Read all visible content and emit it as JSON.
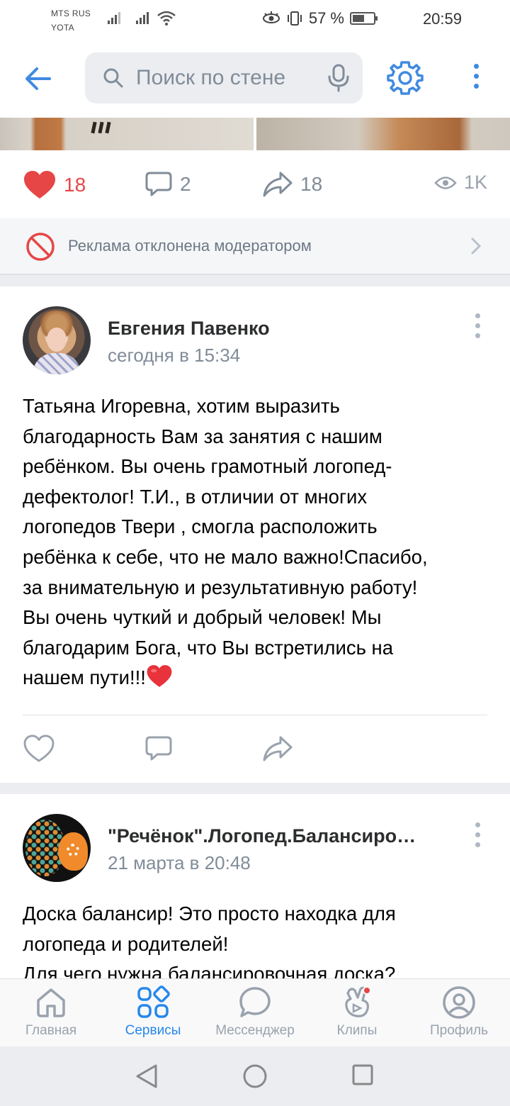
{
  "status": {
    "carrier_line1": "MTS RUS",
    "carrier_line2": "YOTA",
    "battery": "57 %",
    "battery_level": 0.57,
    "time": "20:59"
  },
  "header": {
    "search_placeholder": "Поиск по стене"
  },
  "post1": {
    "likes": "18",
    "comments": "2",
    "shares": "18",
    "views": "1K",
    "ad_note": "Реклама отклонена модератором"
  },
  "post2": {
    "author": "Евгения Павенко",
    "time": "сегодня в 15:34",
    "lines": [
      "Татьяна Игоревна, хотим выразить",
      "благодарность Вам за занятия с нашим",
      "ребёнком. Вы очень грамотный логопед-",
      "дефектолог! Т.И., в отличии от многих",
      "логопедов Твери , смогла расположить",
      "ребёнка к себе, что не мало важно!Спасибо,",
      "за внимательную и результативную работу!",
      "Вы очень чуткий и добрый человек! Мы",
      "благодарим Бога, что Вы встретились на",
      "нашем пути!!!"
    ]
  },
  "post3": {
    "author": "\"Речёнок\".Логопед.Балансиро…",
    "time": "21 марта в 20:48",
    "lines": [
      "Доска балансир! Это просто находка для",
      "логопеда и родителей!",
      "Для чего нужна балансировочная доска?"
    ]
  },
  "tabs": [
    {
      "label": "Главная",
      "icon": "home-icon"
    },
    {
      "label": "Сервисы",
      "icon": "services-icon"
    },
    {
      "label": "Мессенджер",
      "icon": "messenger-icon"
    },
    {
      "label": "Клипы",
      "icon": "clips-icon"
    },
    {
      "label": "Профиль",
      "icon": "profile-icon"
    }
  ],
  "colors": {
    "accent": "#2688eb",
    "like": "#e64646",
    "secondary_text": "#818c99"
  }
}
